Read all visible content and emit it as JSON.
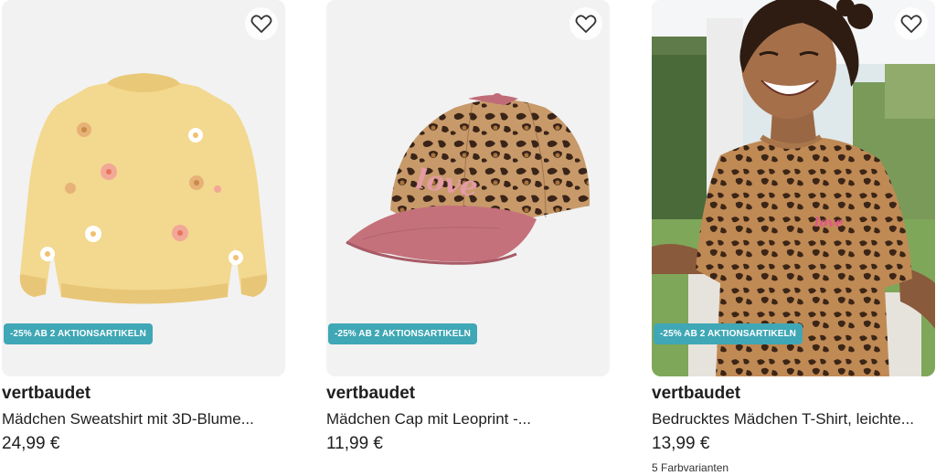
{
  "products": [
    {
      "brand": "vertbaudet",
      "title": "Mädchen Sweatshirt mit 3D-Blume...",
      "price": "24,99 €",
      "badge": "-25% AB 2 AKTIONSARTIKELN",
      "image_icon": "sweatshirt-image",
      "favorite_icon": "heart-outline-icon"
    },
    {
      "brand": "vertbaudet",
      "title": "Mädchen Cap mit Leoprint -...",
      "price": "11,99 €",
      "badge": "-25% AB 2 AKTIONSARTIKELN",
      "image_icon": "cap-image",
      "image_text": "love",
      "favorite_icon": "heart-outline-icon"
    },
    {
      "brand": "vertbaudet",
      "title": "Bedrucktes Mädchen T-Shirt, leichte...",
      "price": "13,99 €",
      "badge": "-25% AB 2 AKTIONSARTIKELN",
      "variants": "5 Farbvarianten",
      "image_icon": "girl-tshirt-photo",
      "image_text": "love",
      "favorite_icon": "heart-outline-icon"
    }
  ],
  "colors": {
    "badge": "#3fa7b5",
    "card_bg": "#f3f3f3",
    "text": "#1f1f1f"
  }
}
